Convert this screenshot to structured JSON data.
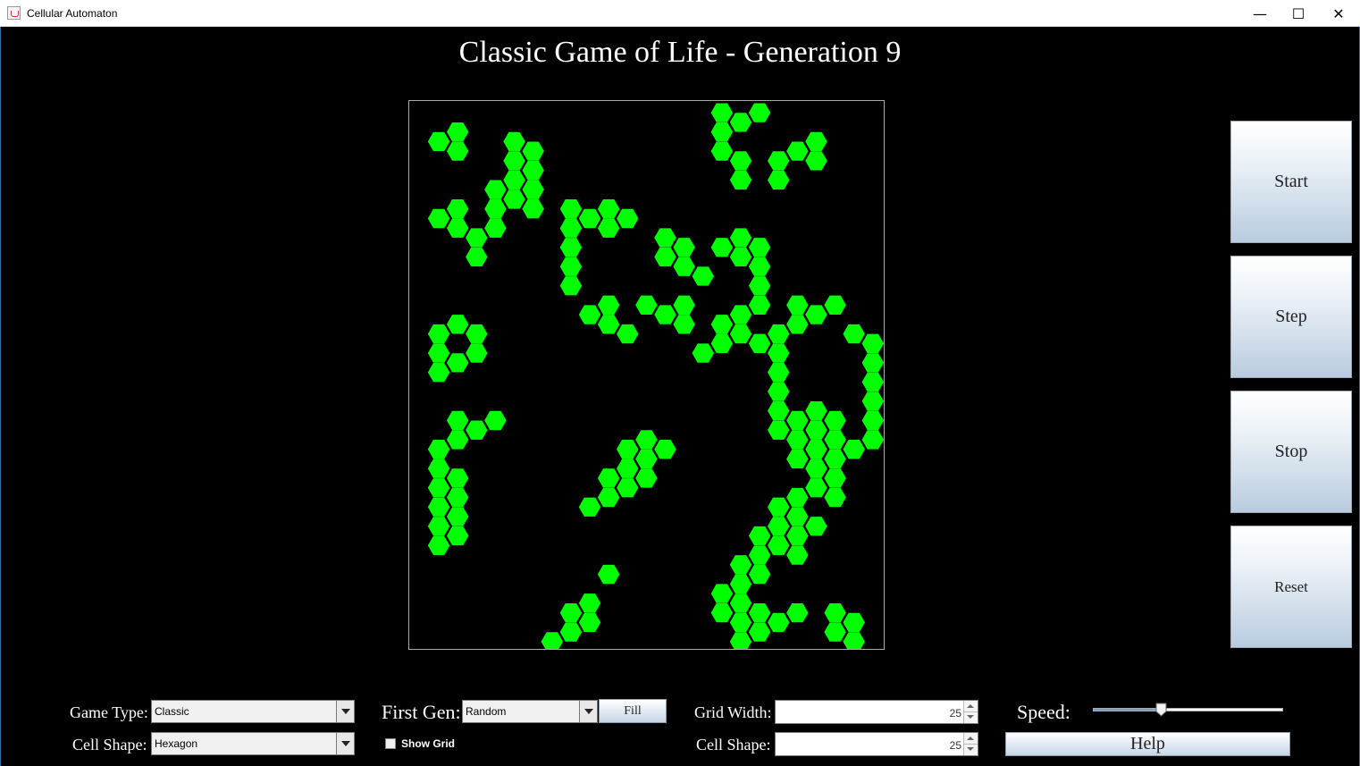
{
  "window": {
    "title": "Cellular Automaton",
    "minimize": "—",
    "maximize": "☐",
    "close": "✕"
  },
  "heading": "Classic Game of Life - Generation 9",
  "board": {
    "columns": 25,
    "rows": 25,
    "alive_color": "#00ff00",
    "grid_visible": false,
    "live_cells": [
      [
        1,
        1
      ],
      [
        2,
        1
      ],
      [
        2,
        2
      ],
      [
        5,
        1
      ],
      [
        5,
        2
      ],
      [
        6,
        2
      ],
      [
        5,
        3
      ],
      [
        6,
        3
      ],
      [
        4,
        4
      ],
      [
        5,
        4
      ],
      [
        6,
        4
      ],
      [
        1,
        5
      ],
      [
        2,
        5
      ],
      [
        4,
        5
      ],
      [
        6,
        5
      ],
      [
        2,
        6
      ],
      [
        3,
        6
      ],
      [
        4,
        6
      ],
      [
        3,
        7
      ],
      [
        8,
        5
      ],
      [
        9,
        5
      ],
      [
        10,
        5
      ],
      [
        11,
        5
      ],
      [
        8,
        6
      ],
      [
        10,
        6
      ],
      [
        8,
        7
      ],
      [
        8,
        8
      ],
      [
        8,
        9
      ],
      [
        9,
        10
      ],
      [
        10,
        10
      ],
      [
        10,
        11
      ],
      [
        11,
        11
      ],
      [
        13,
        6
      ],
      [
        17,
        6
      ],
      [
        13,
        7
      ],
      [
        14,
        7
      ],
      [
        16,
        7
      ],
      [
        17,
        7
      ],
      [
        18,
        7
      ],
      [
        14,
        8
      ],
      [
        15,
        8
      ],
      [
        18,
        8
      ],
      [
        18,
        9
      ],
      [
        12,
        10
      ],
      [
        13,
        10
      ],
      [
        14,
        10
      ],
      [
        17,
        10
      ],
      [
        18,
        10
      ],
      [
        14,
        11
      ],
      [
        16,
        11
      ],
      [
        17,
        11
      ],
      [
        15,
        12
      ],
      [
        16,
        12
      ],
      [
        16,
        0
      ],
      [
        17,
        0
      ],
      [
        18,
        0
      ],
      [
        16,
        1
      ],
      [
        21,
        1
      ],
      [
        16,
        2
      ],
      [
        17,
        2
      ],
      [
        19,
        2
      ],
      [
        20,
        2
      ],
      [
        21,
        2
      ],
      [
        17,
        3
      ],
      [
        19,
        3
      ],
      [
        20,
        10
      ],
      [
        21,
        10
      ],
      [
        22,
        10
      ],
      [
        19,
        11
      ],
      [
        20,
        11
      ],
      [
        23,
        11
      ],
      [
        18,
        12
      ],
      [
        19,
        12
      ],
      [
        24,
        12
      ],
      [
        19,
        13
      ],
      [
        24,
        13
      ],
      [
        19,
        14
      ],
      [
        24,
        14
      ],
      [
        19,
        15
      ],
      [
        21,
        15
      ],
      [
        24,
        15
      ],
      [
        19,
        16
      ],
      [
        20,
        16
      ],
      [
        21,
        16
      ],
      [
        22,
        16
      ],
      [
        24,
        16
      ],
      [
        20,
        17
      ],
      [
        21,
        17
      ],
      [
        22,
        17
      ],
      [
        23,
        17
      ],
      [
        24,
        17
      ],
      [
        20,
        18
      ],
      [
        21,
        18
      ],
      [
        22,
        18
      ],
      [
        21,
        19
      ],
      [
        22,
        19
      ],
      [
        19,
        20
      ],
      [
        20,
        20
      ],
      [
        22,
        20
      ],
      [
        19,
        21
      ],
      [
        20,
        21
      ],
      [
        21,
        21
      ],
      [
        18,
        22
      ],
      [
        19,
        22
      ],
      [
        20,
        22
      ],
      [
        17,
        23
      ],
      [
        18,
        23
      ],
      [
        20,
        23
      ],
      [
        17,
        24
      ],
      [
        18,
        24
      ],
      [
        16,
        25
      ],
      [
        17,
        25
      ],
      [
        16,
        26
      ],
      [
        17,
        26
      ],
      [
        18,
        26
      ],
      [
        19,
        26
      ],
      [
        20,
        26
      ],
      [
        17,
        27
      ],
      [
        18,
        27
      ],
      [
        22,
        26
      ],
      [
        23,
        26
      ],
      [
        22,
        27
      ],
      [
        23,
        27
      ],
      [
        1,
        11
      ],
      [
        2,
        11
      ],
      [
        3,
        11
      ],
      [
        1,
        12
      ],
      [
        3,
        12
      ],
      [
        1,
        13
      ],
      [
        2,
        13
      ],
      [
        2,
        16
      ],
      [
        3,
        16
      ],
      [
        4,
        16
      ],
      [
        1,
        17
      ],
      [
        2,
        17
      ],
      [
        1,
        18
      ],
      [
        1,
        19
      ],
      [
        2,
        19
      ],
      [
        1,
        20
      ],
      [
        2,
        20
      ],
      [
        1,
        21
      ],
      [
        2,
        21
      ],
      [
        1,
        22
      ],
      [
        2,
        22
      ],
      [
        11,
        17
      ],
      [
        12,
        17
      ],
      [
        13,
        17
      ],
      [
        11,
        18
      ],
      [
        12,
        18
      ],
      [
        10,
        19
      ],
      [
        11,
        19
      ],
      [
        12,
        19
      ],
      [
        9,
        20
      ],
      [
        10,
        20
      ],
      [
        10,
        24
      ],
      [
        9,
        25
      ],
      [
        8,
        26
      ],
      [
        9,
        26
      ],
      [
        7,
        27
      ],
      [
        8,
        27
      ]
    ]
  },
  "side_buttons": {
    "start": "Start",
    "step": "Step",
    "stop": "Stop",
    "reset": "Reset"
  },
  "controls": {
    "game_type_label": "Game Type:",
    "game_type_value": "Classic",
    "cell_shape_label": "Cell Shape:",
    "cell_shape_value": "Hexagon",
    "first_gen_label": "First Gen:",
    "first_gen_value": "Random",
    "fill_label": "Fill",
    "show_grid_label": "Show Grid",
    "show_grid_checked": false,
    "grid_width_label": "Grid Width:",
    "grid_width_value": "25",
    "cell_shape2_label": "Cell Shape:",
    "cell_shape2_value": "25",
    "speed_label": "Speed:",
    "speed_value": 0.35,
    "help_label": "Help"
  }
}
